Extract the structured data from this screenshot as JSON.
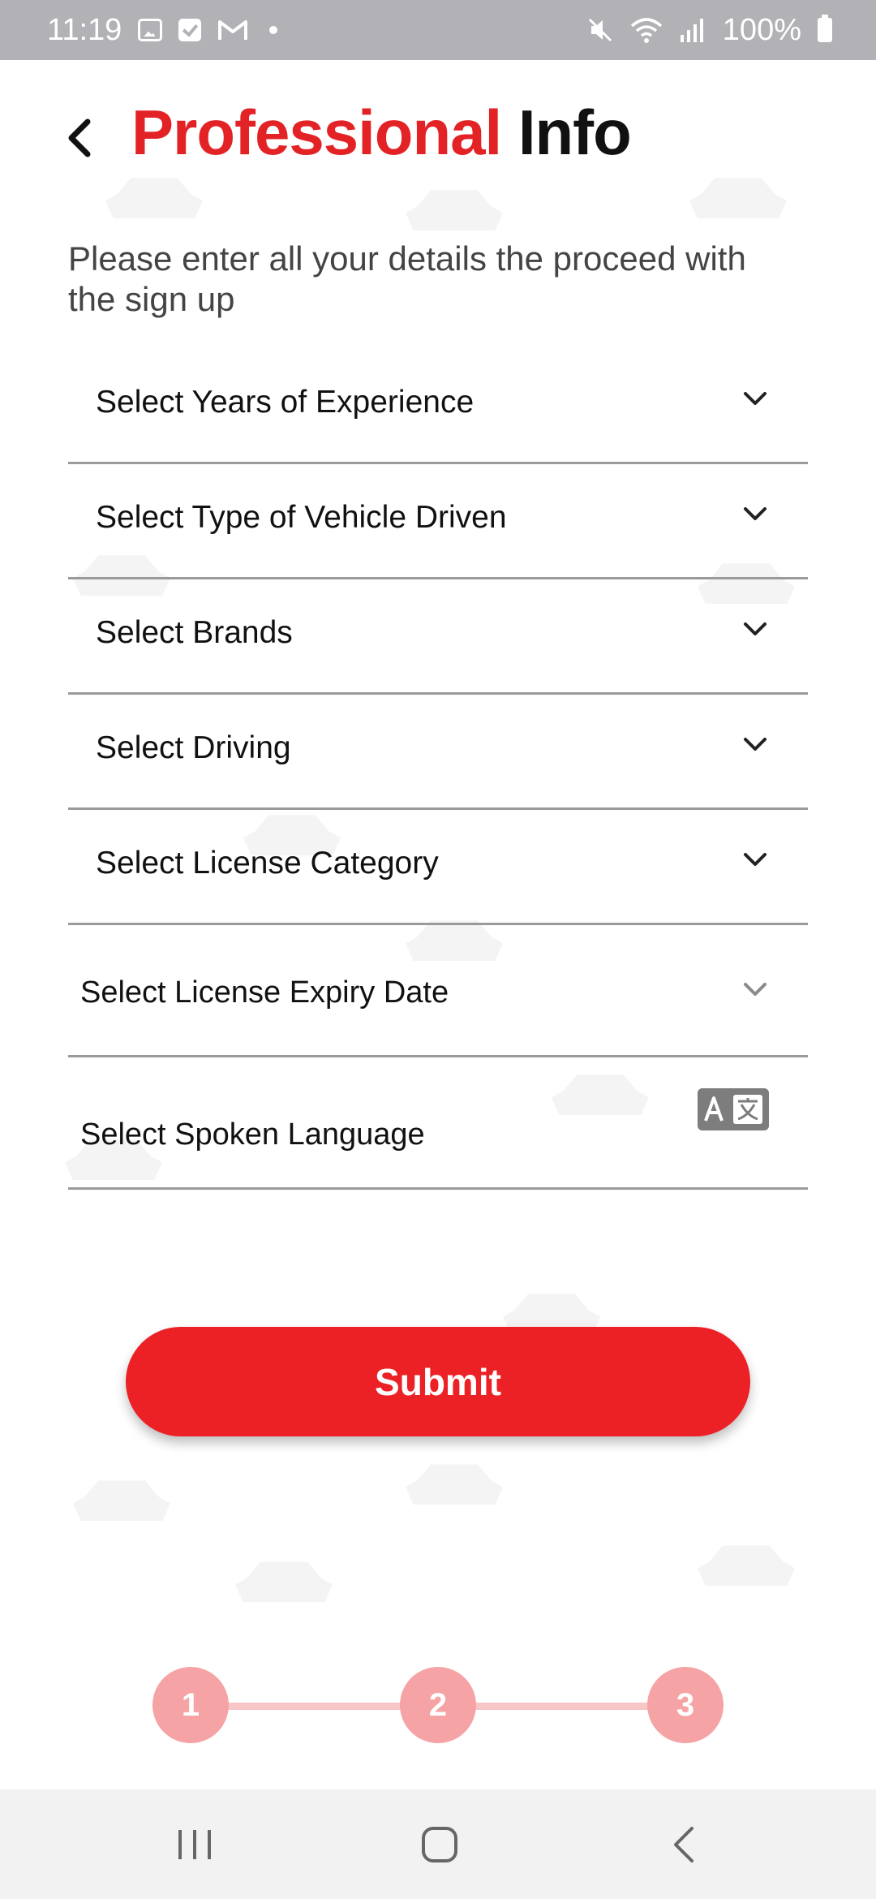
{
  "status_bar": {
    "time": "11:19",
    "battery": "100%",
    "icons": [
      "gallery-icon",
      "check-icon",
      "gmail-icon",
      "notification-dot-icon",
      "mute-icon",
      "wifi-icon",
      "signal-icon",
      "battery-icon"
    ]
  },
  "header": {
    "title_red": "Professional",
    "title_black": "Info",
    "subtitle": "Please enter all your details the proceed with the sign up"
  },
  "form": {
    "years_experience": "Select Years of Experience",
    "vehicle_type": "Select Type of Vehicle Driven",
    "brands": "Select Brands",
    "driving": "Select Driving",
    "license_category": "Select License Category",
    "license_expiry": "Select License Expiry Date",
    "spoken_language": "Select  Spoken Language"
  },
  "submit_label": "Submit",
  "stepper": {
    "steps": [
      "1",
      "2",
      "3"
    ]
  },
  "colors": {
    "accent": "#ec2126",
    "step": "#f5a3a5",
    "step_line": "#f8c6c6"
  }
}
